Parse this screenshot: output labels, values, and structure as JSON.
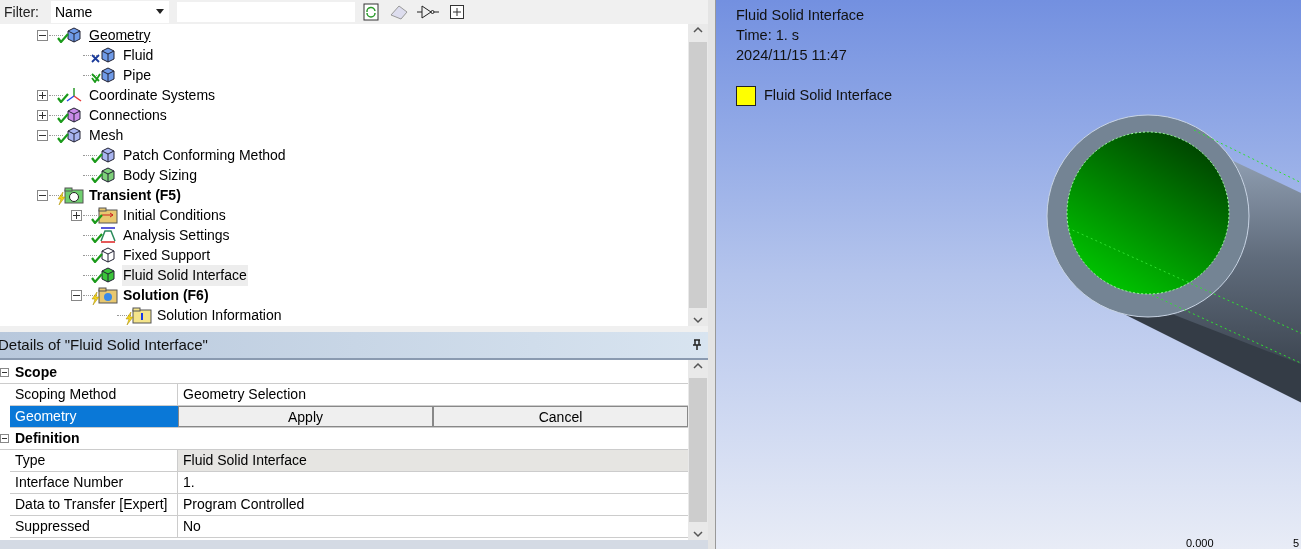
{
  "filter": {
    "label": "Filter:",
    "field": "Name"
  },
  "tree": [
    {
      "label": "Geometry",
      "kind": "geometry",
      "ok": true,
      "crossed": false,
      "pending": false,
      "bold": false,
      "underlined": true,
      "selected": false,
      "expanded": true,
      "children": [
        {
          "label": "Fluid",
          "kind": "body",
          "ok": false,
          "crossed": true,
          "pending": false,
          "bold": false,
          "selected": false
        },
        {
          "label": "Pipe",
          "kind": "body",
          "ok": true,
          "crossed": true,
          "pending": false,
          "bold": false,
          "selected": false
        }
      ]
    },
    {
      "label": "Coordinate Systems",
      "kind": "coords",
      "ok": true,
      "crossed": false,
      "pending": false,
      "bold": false,
      "selected": false,
      "expanded": false
    },
    {
      "label": "Connections",
      "kind": "connections",
      "ok": true,
      "crossed": false,
      "pending": false,
      "bold": false,
      "selected": false,
      "expanded": false
    },
    {
      "label": "Mesh",
      "kind": "mesh",
      "ok": true,
      "crossed": false,
      "pending": false,
      "bold": false,
      "selected": false,
      "expanded": true,
      "children": [
        {
          "label": "Patch Conforming Method",
          "kind": "mesh",
          "ok": true,
          "crossed": false,
          "pending": false,
          "bold": false,
          "selected": false
        },
        {
          "label": "Body Sizing",
          "kind": "sizing",
          "ok": true,
          "crossed": false,
          "pending": false,
          "bold": false,
          "selected": false
        }
      ]
    },
    {
      "label": "Transient (F5)",
      "kind": "transient",
      "pending": true,
      "bold": true,
      "selected": false,
      "expanded": true,
      "children": [
        {
          "label": "Initial Conditions",
          "kind": "initial",
          "ok": true,
          "crossed": false,
          "pending": false,
          "bold": false,
          "selected": false,
          "expanded": false
        },
        {
          "label": "Analysis Settings",
          "kind": "analysis",
          "ok": true,
          "crossed": false,
          "pending": false,
          "bold": false,
          "selected": false
        },
        {
          "label": "Fixed Support",
          "kind": "support",
          "ok": true,
          "crossed": false,
          "pending": false,
          "bold": false,
          "selected": false
        },
        {
          "label": "Fluid Solid Interface",
          "kind": "interface",
          "ok": true,
          "crossed": false,
          "pending": false,
          "bold": false,
          "selected": true
        },
        {
          "label": "Solution (F6)",
          "kind": "solution",
          "pending": true,
          "bold": true,
          "selected": false,
          "expanded": true,
          "children": [
            {
              "label": "Solution Information",
              "kind": "info",
              "pending": true,
              "bold": false,
              "selected": false
            }
          ]
        }
      ]
    }
  ],
  "details": {
    "title": "Details of \"Fluid Solid Interface\"",
    "rows": [
      {
        "kind": "category",
        "label": "Scope",
        "expanded": true
      },
      {
        "kind": "row",
        "label": "Scoping Method",
        "value": "Geometry Selection",
        "readonly": false
      },
      {
        "kind": "editing",
        "label": "Geometry",
        "buttons": [
          "Apply",
          "Cancel"
        ]
      },
      {
        "kind": "category",
        "label": "Definition",
        "expanded": true
      },
      {
        "kind": "row",
        "label": "Type",
        "value": "Fluid Solid Interface",
        "readonly": true
      },
      {
        "kind": "row",
        "label": "Interface Number",
        "value": "1.",
        "readonly": false
      },
      {
        "kind": "row",
        "label": "Data to Transfer [Expert]",
        "value": "Program Controlled",
        "readonly": false
      },
      {
        "kind": "row",
        "label": "Suppressed",
        "value": "No",
        "readonly": false
      }
    ]
  },
  "viewport": {
    "lines": [
      "Fluid Solid Interface",
      "Time: 1. s",
      "2024/11/15 11:47"
    ],
    "legend": [
      {
        "label": "Fluid Solid Interface",
        "color": "#ffff00"
      }
    ],
    "scale_labels": [
      "0.000",
      "5"
    ]
  }
}
